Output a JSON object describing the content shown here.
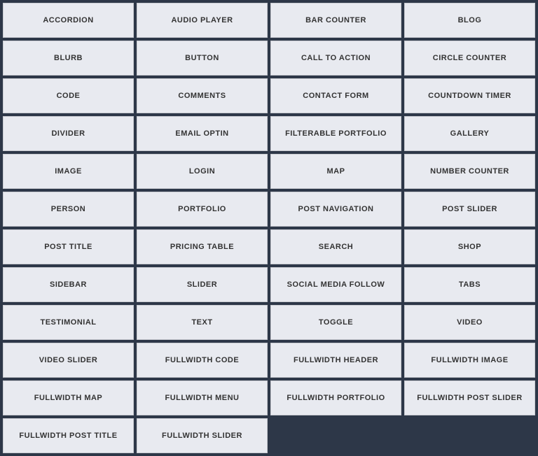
{
  "items": [
    {
      "id": "accordion",
      "label": "ACCORDION"
    },
    {
      "id": "audio-player",
      "label": "AUDIO PLAYER"
    },
    {
      "id": "bar-counter",
      "label": "BAR COUNTER"
    },
    {
      "id": "blog",
      "label": "BLOG"
    },
    {
      "id": "blurb",
      "label": "BLURB"
    },
    {
      "id": "button",
      "label": "BUTTON"
    },
    {
      "id": "call-to-action",
      "label": "CALL TO ACTION"
    },
    {
      "id": "circle-counter",
      "label": "CIRCLE COUNTER"
    },
    {
      "id": "code",
      "label": "CODE"
    },
    {
      "id": "comments",
      "label": "COMMENTS"
    },
    {
      "id": "contact-form",
      "label": "CONTACT FORM"
    },
    {
      "id": "countdown-timer",
      "label": "COUNTDOWN TIMER"
    },
    {
      "id": "divider",
      "label": "DIVIDER"
    },
    {
      "id": "email-optin",
      "label": "EMAIL OPTIN"
    },
    {
      "id": "filterable-portfolio",
      "label": "FILTERABLE PORTFOLIO"
    },
    {
      "id": "gallery",
      "label": "GALLERY"
    },
    {
      "id": "image",
      "label": "IMAGE"
    },
    {
      "id": "login",
      "label": "LOGIN"
    },
    {
      "id": "map",
      "label": "MAP"
    },
    {
      "id": "number-counter",
      "label": "NUMBER COUNTER"
    },
    {
      "id": "person",
      "label": "PERSON"
    },
    {
      "id": "portfolio",
      "label": "PORTFOLIO"
    },
    {
      "id": "post-navigation",
      "label": "POST NAVIGATION"
    },
    {
      "id": "post-slider",
      "label": "POST SLIDER"
    },
    {
      "id": "post-title",
      "label": "POST TITLE"
    },
    {
      "id": "pricing-table",
      "label": "PRICING TABLE"
    },
    {
      "id": "search",
      "label": "SEARCH"
    },
    {
      "id": "shop",
      "label": "SHOP"
    },
    {
      "id": "sidebar",
      "label": "SIDEBAR"
    },
    {
      "id": "slider",
      "label": "SLIDER"
    },
    {
      "id": "social-media-follow",
      "label": "SOCIAL MEDIA FOLLOW"
    },
    {
      "id": "tabs",
      "label": "TABS"
    },
    {
      "id": "testimonial",
      "label": "TESTIMONIAL"
    },
    {
      "id": "text",
      "label": "TEXT"
    },
    {
      "id": "toggle",
      "label": "TOGGLE"
    },
    {
      "id": "video",
      "label": "VIDEO"
    },
    {
      "id": "video-slider",
      "label": "VIDEO SLIDER"
    },
    {
      "id": "fullwidth-code",
      "label": "FULLWIDTH CODE"
    },
    {
      "id": "fullwidth-header",
      "label": "FULLWIDTH HEADER"
    },
    {
      "id": "fullwidth-image",
      "label": "FULLWIDTH IMAGE"
    },
    {
      "id": "fullwidth-map",
      "label": "FULLWIDTH MAP"
    },
    {
      "id": "fullwidth-menu",
      "label": "FULLWIDTH MENU"
    },
    {
      "id": "fullwidth-portfolio",
      "label": "FULLWIDTH PORTFOLIO"
    },
    {
      "id": "fullwidth-post-slider",
      "label": "FULLWIDTH POST SLIDER"
    },
    {
      "id": "fullwidth-post-title",
      "label": "FULLWIDTH POST TITLE"
    },
    {
      "id": "fullwidth-slider",
      "label": "FULLWIDTH SLIDER"
    }
  ]
}
